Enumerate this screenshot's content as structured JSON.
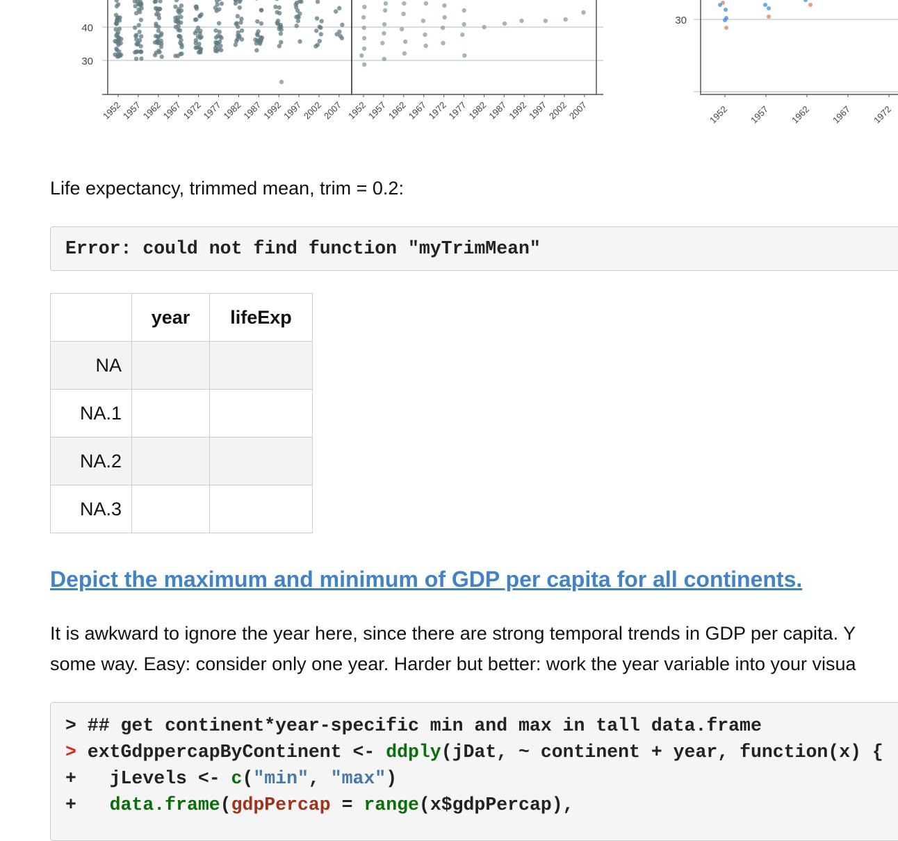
{
  "charts": {
    "left_plot": {
      "y_ticks": [
        "40",
        "30"
      ],
      "x_ticks_panel1": [
        "1952",
        "1957",
        "1962",
        "1967",
        "1972",
        "1977",
        "1982",
        "1987",
        "1992",
        "1997",
        "2002",
        "2007"
      ],
      "x_ticks_panel2": [
        "1952",
        "1957",
        "1962",
        "1967",
        "1972",
        "1977",
        "1982",
        "1987",
        "1992",
        "1997",
        "2002",
        "2007"
      ],
      "point_color": "#5f7a82"
    },
    "right_plot": {
      "y_ticks": [
        "30"
      ],
      "x_ticks": [
        "1952",
        "1957",
        "1962",
        "1967",
        "1972"
      ],
      "colors": {
        "blue": "#3a8ee0",
        "orange": "#e07a5a"
      }
    }
  },
  "caption": "Life expectancy, trimmed mean, trim = 0.2:",
  "error_output": "Error: could not find function \"myTrimMean\"",
  "table": {
    "headers": [
      "",
      "year",
      "lifeExp"
    ],
    "rows": [
      {
        "label": "NA",
        "year": "",
        "lifeExp": ""
      },
      {
        "label": "NA.1",
        "year": "",
        "lifeExp": ""
      },
      {
        "label": "NA.2",
        "year": "",
        "lifeExp": ""
      },
      {
        "label": "NA.3",
        "year": "",
        "lifeExp": ""
      }
    ]
  },
  "section_heading": "Depict the maximum and minimum of GDP per capita for all continents.",
  "paragraph": {
    "line1": "It is awkward to ignore the year here, since there are strong temporal trends in GDP per capita. Y",
    "line2": "some way. Easy: consider only one year. Harder but better: work the year variable into your visua"
  },
  "code": {
    "line1": {
      "prompt": ">",
      "text": " ## get continent*year-specific min and max in tall data.frame"
    },
    "line2": {
      "prompt": ">",
      "a": " extGdppercapByContinent <- ",
      "fn": "ddply",
      "b": "(jDat, ~ continent + year, function(x) {"
    },
    "line3": {
      "prompt": "+",
      "a": "   jLevels <- ",
      "fn": "c",
      "b": "(",
      "s1": "\"min\"",
      "c": ", ",
      "s2": "\"max\"",
      "d": ")"
    },
    "line4": {
      "prompt": "+",
      "a": "   ",
      "fn1": "data.frame",
      "b": "(",
      "arg": "gdpPercap",
      "c": " = ",
      "fn2": "range",
      "d": "(x$gdpPercap),"
    }
  }
}
